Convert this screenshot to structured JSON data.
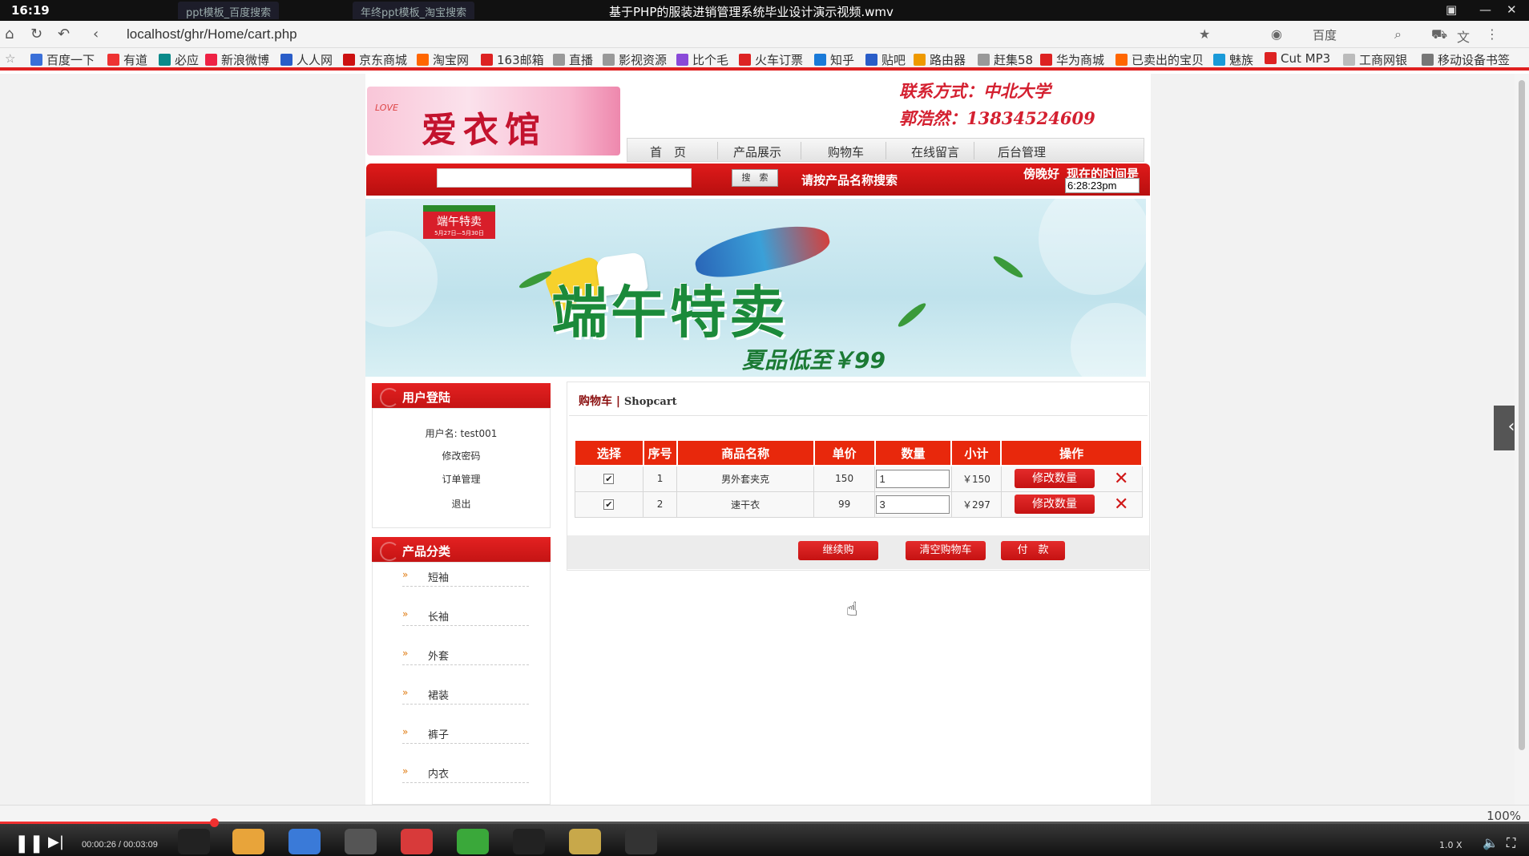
{
  "window": {
    "clock": "16:19",
    "tabs": [
      "ppt模板_百度搜索",
      "年终ppt模板_淘宝搜索"
    ],
    "title": "基于PHP的服装进销管理系统毕业设计演示视频.wmv"
  },
  "browser": {
    "url": "localhost/ghr/Home/cart.php",
    "search_engine": "百度",
    "zoom": "100%",
    "bookmarks": [
      "百度一下",
      "有道",
      "必应",
      "新浪微博",
      "人人网",
      "京东商城",
      "淘宝网",
      "163邮箱",
      "直播",
      "影视资源",
      "比个毛",
      "火车订票",
      "知乎",
      "贴吧",
      "路由器",
      "赶集58",
      "华为商城",
      "已卖出的宝贝",
      "魅族",
      "Cut MP3",
      "工商网银",
      "移动设备书签"
    ]
  },
  "site": {
    "logo_text": "爱衣馆",
    "logo_small": "LOVE",
    "contact_line1": "联系方式：中北大学",
    "contact_line2": "郭浩然：13834524609",
    "nav": [
      "首　页",
      "产品展示",
      "购物车",
      "在线留言",
      "后台管理"
    ],
    "search": {
      "button": "搜　索",
      "hint": "请按产品名称搜索",
      "greeting": "傍晚好",
      "time_label": "现在的时间是",
      "time_value": "6:28:23pm"
    },
    "banner": {
      "tag": "端午特卖",
      "tag_sub": "5月27日—5月30日",
      "headline": "端午特卖",
      "subline": "夏品低至￥99"
    },
    "login": {
      "title": "用户登陆",
      "username": "用户名: test001",
      "links": [
        "修改密码",
        "订单管理",
        "退出"
      ]
    },
    "categories": {
      "title": "产品分类",
      "items": [
        "短袖",
        "长袖",
        "外套",
        "裙装",
        "裤子",
        "内衣"
      ]
    }
  },
  "cart": {
    "title_cn": "购物车",
    "title_en": "Shopcart",
    "columns": [
      "选择",
      "序号",
      "商品名称",
      "单价",
      "数量",
      "小计",
      "操作"
    ],
    "rows": [
      {
        "checked": "✔",
        "no": "1",
        "name": "男外套夹克",
        "price": "150",
        "qty": "1",
        "subtotal": "￥150",
        "action": "修改数量"
      },
      {
        "checked": "✔",
        "no": "2",
        "name": "速干衣",
        "price": "99",
        "qty": "3",
        "subtotal": "￥297",
        "action": "修改数量"
      }
    ],
    "buttons": {
      "continue": "继续购",
      "clear": "清空购物车",
      "pay": "付　款"
    }
  },
  "player": {
    "time": "00:00:26 / 00:03:09",
    "speed": "1.0 X",
    "progress": 0.14
  }
}
